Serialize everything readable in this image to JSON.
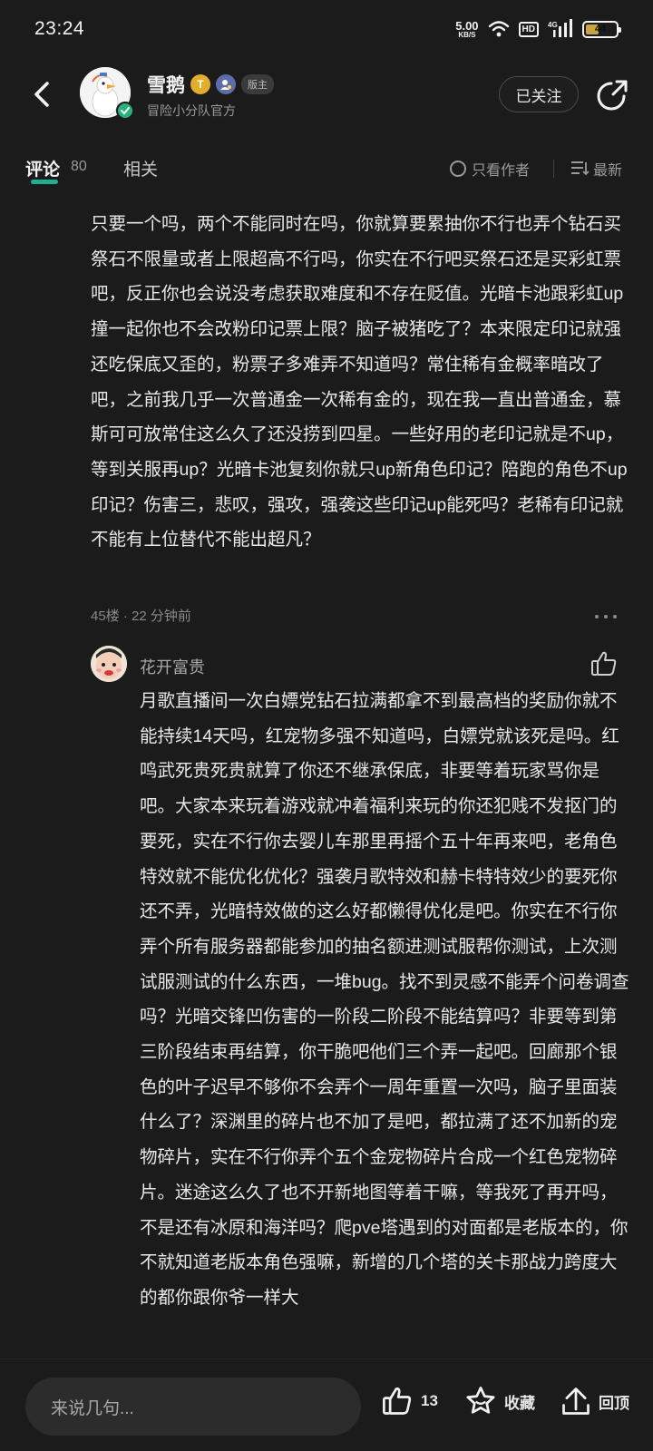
{
  "status_bar": {
    "time": "23:24",
    "net_speed": "5.00",
    "net_unit": "KB/S",
    "hd": "HD",
    "network_type": "4G",
    "battery": "44",
    "battery_fraction": 0.44
  },
  "header": {
    "author_name": "雪鹅",
    "level_badge": "T",
    "mod_badge": "版主",
    "author_subtitle": "冒险小分队官方",
    "follow_label": "已关注"
  },
  "tabs": {
    "comments_label": "评论",
    "comments_count": "80",
    "related_label": "相关",
    "only_author_label": "只看作者",
    "sort_label": "最新"
  },
  "comment": {
    "text": "只要一个吗，两个不能同时在吗，你就算要累抽你不行也弄个钻石买祭石不限量或者上限超高不行吗，你实在不行吧买祭石还是买彩虹票吧，反正你也会说没考虑获取难度和不存在贬值。光暗卡池跟彩虹up撞一起你也不会改粉印记票上限？脑子被猪吃了？本来限定印记就强还吃保底又歪的，粉票子多难弄不知道吗？常住稀有金概率暗改了吧，之前我几乎一次普通金一次稀有金的，现在我一直出普通金，慕斯可可放常住这么久了还没捞到四星。一些好用的老印记就是不up，等到关服再up？光暗卡池复刻你就只up新角色印记？陪跑的角色不up印记？伤害三，悲叹，强攻，强袭这些印记up能死吗？老稀有印记就不能有上位替代不能出超凡？",
    "meta": "45楼 · 22 分钟前"
  },
  "reply": {
    "author": "花开富贵",
    "text": "月歌直播间一次白嫖党钻石拉满都拿不到最高档的奖励你就不能持续14天吗，红宠物多强不知道吗，白嫖党就该死是吗。红鸣武死贵死贵就算了你还不继承保底，非要等着玩家骂你是吧。大家本来玩着游戏就冲着福利来玩的你还犯贱不发抠门的要死，实在不行你去婴儿车那里再摇个五十年再来吧，老角色特效就不能优化优化？强袭月歌特效和赫卡特特效少的要死你还不弄，光暗特效做的这么好都懒得优化是吧。你实在不行你弄个所有服务器都能参加的抽名额进测试服帮你测试，上次测试服测试的什么东西，一堆bug。找不到灵感不能弄个问卷调查吗？光暗交锋凹伤害的一阶段二阶段不能结算吗？非要等到第三阶段结束再结算，你干脆吧他们三个弄一起吧。回廊那个银色的叶子迟早不够你不会弄个一周年重置一次吗，脑子里面装什么了？深渊里的碎片也不加了是吧，都拉满了还不加新的宠物碎片，实在不行你弄个五个金宠物碎片合成一个红色宠物碎片。迷途这么久了也不开新地图等着干嘛，等我死了再开吗，不是还有冰原和海洋吗？爬pve塔遇到的对面都是老版本的，你不就知道老版本角色强嘛，新增的几个塔的关卡那战力跨度大的都你跟你爷一样大"
  },
  "bottom_bar": {
    "input_placeholder": "来说几句...",
    "like_count": "13",
    "favorite_label": "收藏",
    "top_label": "回顶"
  },
  "colors": {
    "background": "#1b1b1b",
    "accent": "#1fae8e",
    "verified": "#25b37b",
    "level_badge": "#e0ad2d"
  },
  "icons": [
    "back-arrow-icon",
    "share-icon",
    "verified-icon",
    "admin-icon",
    "radio-icon",
    "sort-icon",
    "more-icon",
    "thumbs-up-icon",
    "star-icon",
    "arrow-up-icon",
    "wifi-icon",
    "signal-icon",
    "battery-icon"
  ]
}
